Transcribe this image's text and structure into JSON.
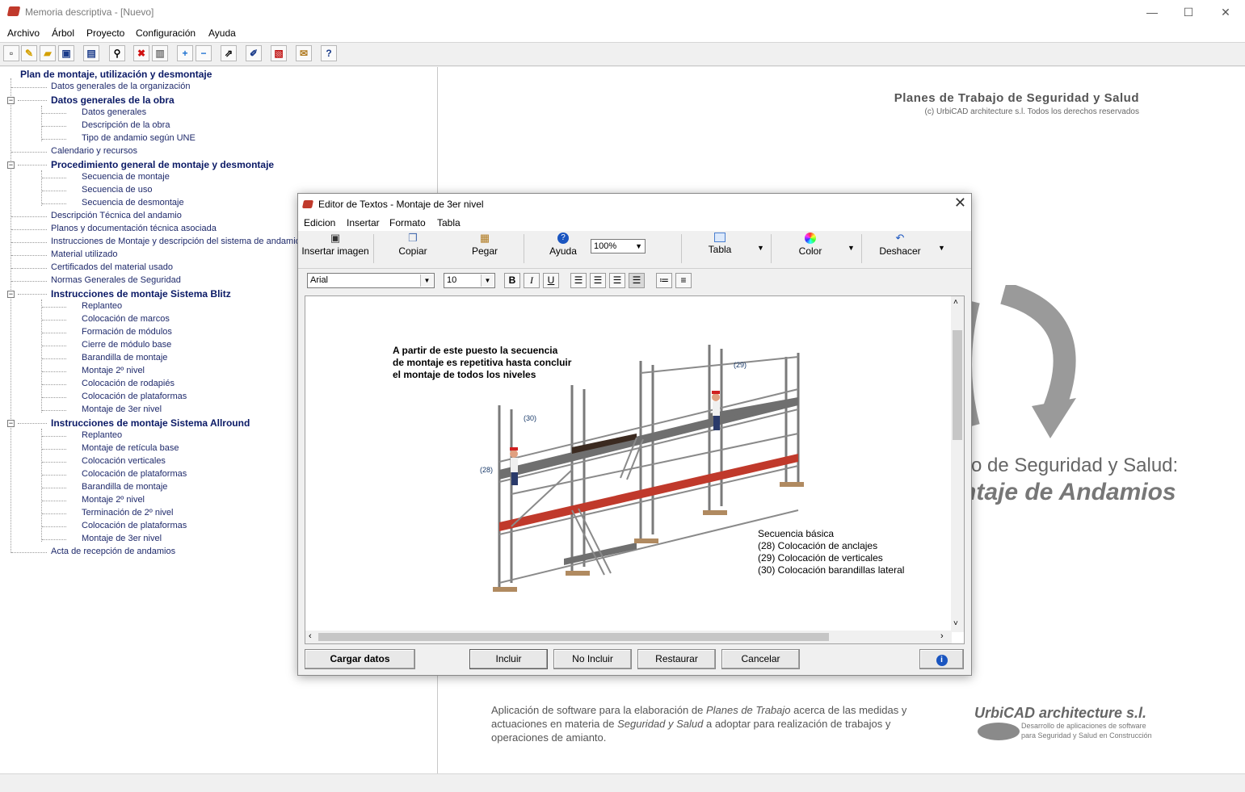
{
  "window": {
    "title": "Memoria descriptiva - [Nuevo]",
    "minimize": "—",
    "maximize": "☐",
    "close": "✕"
  },
  "menu": [
    "Archivo",
    "Árbol",
    "Proyecto",
    "Configuración",
    "Ayuda"
  ],
  "toolbar_icons": [
    "new-file-icon",
    "open-wizard-icon",
    "open-folder-icon",
    "save-icon",
    "preview-icon",
    "find-icon",
    "delete-icon",
    "clipboard-icon",
    "add-icon",
    "remove-icon",
    "export-icon",
    "edit-icon",
    "pdf-icon",
    "certificate-icon",
    "help-icon"
  ],
  "tree": {
    "root": "Plan de montaje, utilización y desmontaje",
    "items": [
      {
        "label": "Datos generales de la organización",
        "level": 1,
        "bold": false
      },
      {
        "label": "Datos generales de la obra",
        "level": 1,
        "bold": true,
        "expander": "−"
      },
      {
        "label": "Datos generales",
        "level": 2,
        "bold": false
      },
      {
        "label": "Descripción de la obra",
        "level": 2,
        "bold": false
      },
      {
        "label": "Tipo de andamio según UNE",
        "level": 2,
        "bold": false
      },
      {
        "label": "Calendario y recursos",
        "level": 1,
        "bold": false
      },
      {
        "label": "Procedimiento general de montaje y desmontaje",
        "level": 1,
        "bold": true,
        "expander": "−"
      },
      {
        "label": "Secuencia de montaje",
        "level": 2,
        "bold": false
      },
      {
        "label": "Secuencia de uso",
        "level": 2,
        "bold": false
      },
      {
        "label": "Secuencia de desmontaje",
        "level": 2,
        "bold": false
      },
      {
        "label": "Descripción Técnica del andamio",
        "level": 1,
        "bold": false
      },
      {
        "label": "Planos y documentación técnica asociada",
        "level": 1,
        "bold": false
      },
      {
        "label": "Instrucciones de Montaje y descripción del sistema de andamios",
        "level": 1,
        "bold": false
      },
      {
        "label": "Material utilizado",
        "level": 1,
        "bold": false
      },
      {
        "label": "Certificados del material usado",
        "level": 1,
        "bold": false
      },
      {
        "label": "Normas Generales de Seguridad",
        "level": 1,
        "bold": false
      },
      {
        "label": "Instrucciones de montaje Sistema Blitz",
        "level": 1,
        "bold": true,
        "expander": "−"
      },
      {
        "label": "Replanteo",
        "level": 2,
        "bold": false
      },
      {
        "label": "Colocación de marcos",
        "level": 2,
        "bold": false
      },
      {
        "label": "Formación de módulos",
        "level": 2,
        "bold": false
      },
      {
        "label": "Cierre de módulo base",
        "level": 2,
        "bold": false
      },
      {
        "label": "Barandilla de montaje",
        "level": 2,
        "bold": false
      },
      {
        "label": "Montaje 2º nivel",
        "level": 2,
        "bold": false
      },
      {
        "label": "Colocación de rodapiés",
        "level": 2,
        "bold": false
      },
      {
        "label": "Colocación de plataformas",
        "level": 2,
        "bold": false
      },
      {
        "label": "Montaje de 3er nivel",
        "level": 2,
        "bold": false
      },
      {
        "label": "Instrucciones de montaje Sistema Allround",
        "level": 1,
        "bold": true,
        "expander": "−"
      },
      {
        "label": "Replanteo",
        "level": 2,
        "bold": false
      },
      {
        "label": "Montaje de retícula base",
        "level": 2,
        "bold": false
      },
      {
        "label": "Colocación verticales",
        "level": 2,
        "bold": false
      },
      {
        "label": "Colocación de plataformas",
        "level": 2,
        "bold": false
      },
      {
        "label": "Barandilla de montaje",
        "level": 2,
        "bold": false
      },
      {
        "label": "Montaje 2º nivel",
        "level": 2,
        "bold": false
      },
      {
        "label": "Terminación de 2º nivel",
        "level": 2,
        "bold": false
      },
      {
        "label": "Colocación de plataformas",
        "level": 2,
        "bold": false
      },
      {
        "label": "Montaje de 3er nivel",
        "level": 2,
        "bold": false
      },
      {
        "label": "Acta de recepción de andamios",
        "level": 1,
        "bold": false
      }
    ]
  },
  "background": {
    "brand_title": "Planes de Trabajo de Seguridad y Salud",
    "brand_copyright": "(c) UrbiCAD architecture s.l.   Todos los derechos reservados",
    "big_line1": "o de Seguridad y Salud:",
    "big_line2": "ntaje de Andamios",
    "footer_desc_1": "Aplicación de software para la elaboración de",
    "footer_desc_2": "Planes de Trabajo",
    "footer_desc_3": "acerca de las medidas y actuaciones en materia de",
    "footer_desc_4": "Seguridad y Salud",
    "footer_desc_5": "a adoptar para realización de trabajos y operaciones de amianto.",
    "footer_brand": "UrbiCAD architecture s.l.",
    "footer_sub_1": "Desarrollo de aplicaciones de software",
    "footer_sub_2": "para Seguridad y Salud en Construcción",
    "accent_gray": "#9a9a9a"
  },
  "dialog": {
    "title": "Editor de Textos - Montaje de 3er nivel",
    "close": "✕",
    "menu": [
      "Edicion",
      "Insertar",
      "Formato",
      "Tabla"
    ],
    "tools": {
      "insert_image": "Insertar imagen",
      "copy": "Copiar",
      "paste": "Pegar",
      "help": "Ayuda",
      "zoom": "100%",
      "table": "Tabla",
      "color": "Color",
      "undo": "Deshacer"
    },
    "font": "Arial",
    "size": "10",
    "format_buttons": {
      "bold": "B",
      "italic": "I",
      "underline": "U"
    },
    "content": {
      "caption_1": "A partir de este puesto la secuencia",
      "caption_2": "de montaje es repetitiva hasta concluir",
      "caption_3": "el montaje de todos los niveles",
      "label_28": "(28)",
      "label_29": "(29)",
      "label_30": "(30)",
      "seq_title": "Secuencia básica",
      "seq_28": "(28) Colocación de anclajes",
      "seq_29": "(29) Colocación de verticales",
      "seq_30": "(30) Colocación barandillas lateral"
    },
    "buttons": {
      "load": "Cargar datos",
      "include": "Incluir",
      "exclude": "No Incluir",
      "restore": "Restaurar",
      "cancel": "Cancelar"
    },
    "colors": {
      "scaffold_red": "#c0392b",
      "deck_gray": "#6f6f6f",
      "dark_deck": "#3b2a20"
    }
  }
}
